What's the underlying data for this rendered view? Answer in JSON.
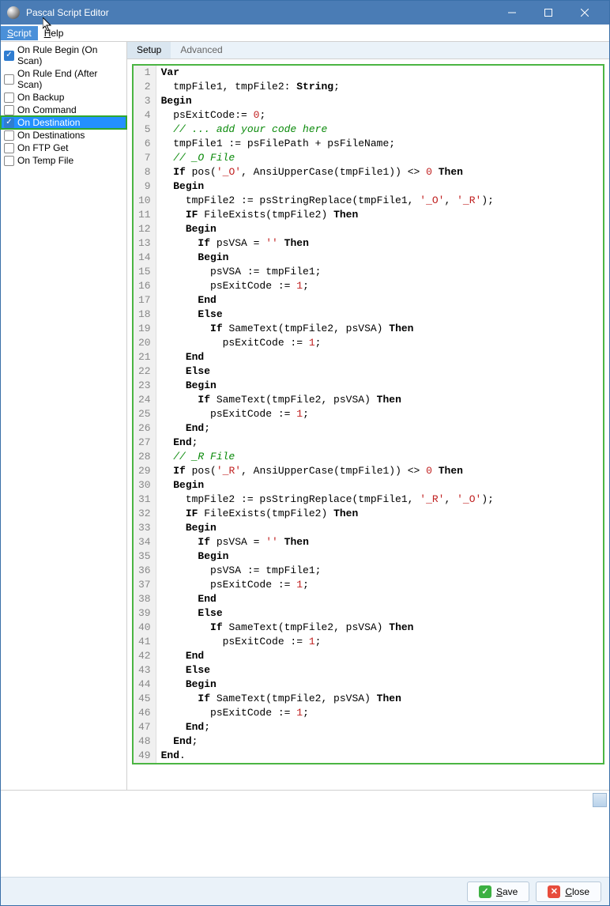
{
  "window": {
    "title": "Pascal Script Editor"
  },
  "menu": {
    "items": [
      "Script",
      "Help"
    ],
    "active": 0
  },
  "sidebar": {
    "items": [
      {
        "label": "On Rule Begin (On Scan)",
        "checked": true,
        "selected": false
      },
      {
        "label": "On Rule End (After Scan)",
        "checked": false,
        "selected": false
      },
      {
        "label": "On Backup",
        "checked": false,
        "selected": false
      },
      {
        "label": "On Command",
        "checked": false,
        "selected": false
      },
      {
        "label": "On Destination",
        "checked": true,
        "selected": true
      },
      {
        "label": "On Destinations",
        "checked": false,
        "selected": false
      },
      {
        "label": "On FTP Get",
        "checked": false,
        "selected": false
      },
      {
        "label": "On Temp File",
        "checked": false,
        "selected": false
      }
    ]
  },
  "tabs": {
    "items": [
      "Setup",
      "Advanced"
    ],
    "active": 0
  },
  "code": {
    "lines": [
      [
        {
          "t": "Var",
          "c": "kw"
        }
      ],
      [
        {
          "t": "  tmpFile1, tmpFile2: "
        },
        {
          "t": "String",
          "c": "kw"
        },
        {
          "t": ";"
        }
      ],
      [
        {
          "t": "Begin",
          "c": "kw"
        }
      ],
      [
        {
          "t": "  psExitCode:= "
        },
        {
          "t": "0",
          "c": "num"
        },
        {
          "t": ";"
        }
      ],
      [
        {
          "t": "  // ... add your code here",
          "c": "cmt"
        }
      ],
      [
        {
          "t": "  tmpFile1 := psFilePath + psFileName;"
        }
      ],
      [
        {
          "t": "  // _O File",
          "c": "cmt"
        }
      ],
      [
        {
          "t": "  "
        },
        {
          "t": "If",
          "c": "kw"
        },
        {
          "t": " pos("
        },
        {
          "t": "'_O'",
          "c": "str"
        },
        {
          "t": ", AnsiUpperCase(tmpFile1)) <> "
        },
        {
          "t": "0",
          "c": "num"
        },
        {
          "t": " "
        },
        {
          "t": "Then",
          "c": "kw"
        }
      ],
      [
        {
          "t": "  "
        },
        {
          "t": "Begin",
          "c": "kw"
        }
      ],
      [
        {
          "t": "    tmpFile2 := psStringReplace(tmpFile1, "
        },
        {
          "t": "'_O'",
          "c": "str"
        },
        {
          "t": ", "
        },
        {
          "t": "'_R'",
          "c": "str"
        },
        {
          "t": ");"
        }
      ],
      [
        {
          "t": "    "
        },
        {
          "t": "IF",
          "c": "kw"
        },
        {
          "t": " FileExists(tmpFile2) "
        },
        {
          "t": "Then",
          "c": "kw"
        }
      ],
      [
        {
          "t": "    "
        },
        {
          "t": "Begin",
          "c": "kw"
        }
      ],
      [
        {
          "t": "      "
        },
        {
          "t": "If",
          "c": "kw"
        },
        {
          "t": " psVSA = "
        },
        {
          "t": "''",
          "c": "str"
        },
        {
          "t": " "
        },
        {
          "t": "Then",
          "c": "kw"
        }
      ],
      [
        {
          "t": "      "
        },
        {
          "t": "Begin",
          "c": "kw"
        }
      ],
      [
        {
          "t": "        psVSA := tmpFile1;"
        }
      ],
      [
        {
          "t": "        psExitCode := "
        },
        {
          "t": "1",
          "c": "num"
        },
        {
          "t": ";"
        }
      ],
      [
        {
          "t": "      "
        },
        {
          "t": "End",
          "c": "kw"
        }
      ],
      [
        {
          "t": "      "
        },
        {
          "t": "Else",
          "c": "kw"
        }
      ],
      [
        {
          "t": "        "
        },
        {
          "t": "If",
          "c": "kw"
        },
        {
          "t": " SameText(tmpFile2, psVSA) "
        },
        {
          "t": "Then",
          "c": "kw"
        }
      ],
      [
        {
          "t": "          psExitCode := "
        },
        {
          "t": "1",
          "c": "num"
        },
        {
          "t": ";"
        }
      ],
      [
        {
          "t": "    "
        },
        {
          "t": "End",
          "c": "kw"
        }
      ],
      [
        {
          "t": "    "
        },
        {
          "t": "Else",
          "c": "kw"
        }
      ],
      [
        {
          "t": "    "
        },
        {
          "t": "Begin",
          "c": "kw"
        }
      ],
      [
        {
          "t": "      "
        },
        {
          "t": "If",
          "c": "kw"
        },
        {
          "t": " SameText(tmpFile2, psVSA) "
        },
        {
          "t": "Then",
          "c": "kw"
        }
      ],
      [
        {
          "t": "        psExitCode := "
        },
        {
          "t": "1",
          "c": "num"
        },
        {
          "t": ";"
        }
      ],
      [
        {
          "t": "    "
        },
        {
          "t": "End",
          "c": "kw"
        },
        {
          "t": ";"
        }
      ],
      [
        {
          "t": "  "
        },
        {
          "t": "End",
          "c": "kw"
        },
        {
          "t": ";"
        }
      ],
      [
        {
          "t": "  // _R File",
          "c": "cmt"
        }
      ],
      [
        {
          "t": "  "
        },
        {
          "t": "If",
          "c": "kw"
        },
        {
          "t": " pos("
        },
        {
          "t": "'_R'",
          "c": "str"
        },
        {
          "t": ", AnsiUpperCase(tmpFile1)) <> "
        },
        {
          "t": "0",
          "c": "num"
        },
        {
          "t": " "
        },
        {
          "t": "Then",
          "c": "kw"
        }
      ],
      [
        {
          "t": "  "
        },
        {
          "t": "Begin",
          "c": "kw"
        }
      ],
      [
        {
          "t": "    tmpFile2 := psStringReplace(tmpFile1, "
        },
        {
          "t": "'_R'",
          "c": "str"
        },
        {
          "t": ", "
        },
        {
          "t": "'_O'",
          "c": "str"
        },
        {
          "t": ");"
        }
      ],
      [
        {
          "t": "    "
        },
        {
          "t": "IF",
          "c": "kw"
        },
        {
          "t": " FileExists(tmpFile2) "
        },
        {
          "t": "Then",
          "c": "kw"
        }
      ],
      [
        {
          "t": "    "
        },
        {
          "t": "Begin",
          "c": "kw"
        }
      ],
      [
        {
          "t": "      "
        },
        {
          "t": "If",
          "c": "kw"
        },
        {
          "t": " psVSA = "
        },
        {
          "t": "''",
          "c": "str"
        },
        {
          "t": " "
        },
        {
          "t": "Then",
          "c": "kw"
        }
      ],
      [
        {
          "t": "      "
        },
        {
          "t": "Begin",
          "c": "kw"
        }
      ],
      [
        {
          "t": "        psVSA := tmpFile1;"
        }
      ],
      [
        {
          "t": "        psExitCode := "
        },
        {
          "t": "1",
          "c": "num"
        },
        {
          "t": ";"
        }
      ],
      [
        {
          "t": "      "
        },
        {
          "t": "End",
          "c": "kw"
        }
      ],
      [
        {
          "t": "      "
        },
        {
          "t": "Else",
          "c": "kw"
        }
      ],
      [
        {
          "t": "        "
        },
        {
          "t": "If",
          "c": "kw"
        },
        {
          "t": " SameText(tmpFile2, psVSA) "
        },
        {
          "t": "Then",
          "c": "kw"
        }
      ],
      [
        {
          "t": "          psExitCode := "
        },
        {
          "t": "1",
          "c": "num"
        },
        {
          "t": ";"
        }
      ],
      [
        {
          "t": "    "
        },
        {
          "t": "End",
          "c": "kw"
        }
      ],
      [
        {
          "t": "    "
        },
        {
          "t": "Else",
          "c": "kw"
        }
      ],
      [
        {
          "t": "    "
        },
        {
          "t": "Begin",
          "c": "kw"
        }
      ],
      [
        {
          "t": "      "
        },
        {
          "t": "If",
          "c": "kw"
        },
        {
          "t": " SameText(tmpFile2, psVSA) "
        },
        {
          "t": "Then",
          "c": "kw"
        }
      ],
      [
        {
          "t": "        psExitCode := "
        },
        {
          "t": "1",
          "c": "num"
        },
        {
          "t": ";"
        }
      ],
      [
        {
          "t": "    "
        },
        {
          "t": "End",
          "c": "kw"
        },
        {
          "t": ";"
        }
      ],
      [
        {
          "t": "  "
        },
        {
          "t": "End",
          "c": "kw"
        },
        {
          "t": ";"
        }
      ],
      [
        {
          "t": "End",
          "c": "kw"
        },
        {
          "t": "."
        }
      ]
    ]
  },
  "footer": {
    "save": "Save",
    "close": "Close"
  }
}
